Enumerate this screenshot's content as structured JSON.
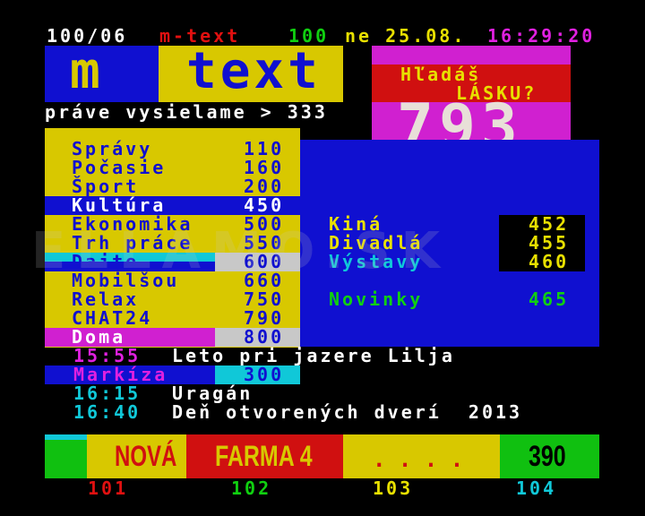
{
  "header": {
    "page": "100/06",
    "brand": "m-text",
    "page_num": "100",
    "date": "ne 25.08.",
    "time": "16:29:20"
  },
  "logo": {
    "m": "m",
    "text": "text"
  },
  "now_playing": "práve vysielame > 333",
  "ad": {
    "line1": "Hľadáš",
    "line2": "LÁSKU?",
    "page": "793"
  },
  "menu": [
    {
      "label": "Správy",
      "page": "110"
    },
    {
      "label": "Počasie",
      "page": "160"
    },
    {
      "label": "Šport",
      "page": "200"
    },
    {
      "label": "Kultúra",
      "page": "450"
    },
    {
      "label": "Ekonomika",
      "page": "500"
    },
    {
      "label": "Trh práce",
      "page": "550"
    },
    {
      "label": "Dajto",
      "page": "600"
    },
    {
      "label": "Mobilšou",
      "page": "660"
    },
    {
      "label": "Relax",
      "page": "750"
    },
    {
      "label": "CHAT24",
      "page": "790"
    },
    {
      "label": "Doma",
      "page": "800"
    }
  ],
  "culture": [
    {
      "label": "Kiná",
      "page": "452"
    },
    {
      "label": "Divadlá",
      "page": "455"
    },
    {
      "label": "Výstavy",
      "page": "460"
    },
    {
      "label": "Novinky",
      "page": "465"
    }
  ],
  "watermark": "ELLAMO.SK",
  "schedule": {
    "row1": {
      "time": "15:55",
      "title": "Leto pri jazere Lilja"
    },
    "markiza": {
      "label": "Markíza",
      "page": "300"
    },
    "row2": {
      "time": "16:15",
      "title": "Uragán"
    },
    "row3": {
      "time": "16:40",
      "title": "Deň otvorených dverí  2013"
    }
  },
  "banner": {
    "nova": "NOVÁ",
    "farma": "FARMA 4",
    "dots": ". . . .",
    "page": "390"
  },
  "fastext": [
    "101",
    "102",
    "103",
    "104"
  ],
  "colors": {
    "blue": "#1010d0",
    "yellow": "#d8c800",
    "magenta": "#d020d0",
    "red": "#d01010",
    "green": "#10c010",
    "cyan": "#10c8d8"
  }
}
